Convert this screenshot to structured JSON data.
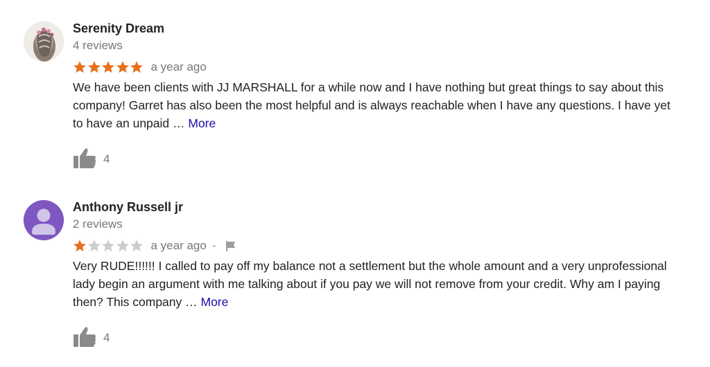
{
  "colors": {
    "star_filled": "#e7711b",
    "star_empty": "#cccccc",
    "link": "#1a0dab",
    "muted": "#777777",
    "avatar_purple": "#7e57c2"
  },
  "reviews": [
    {
      "author": "Serenity Dream",
      "review_count": "4 reviews",
      "rating": 5,
      "rating_max": 5,
      "time": "a year ago",
      "text": "We have been clients with  JJ MARSHALL for a while now and I have nothing but great things to say about this company! Garret has also been the most helpful and is always reachable when I have any questions. I have yet to have an unpaid … ",
      "more_label": "More",
      "likes": "4",
      "avatar_icon": "profile-photo"
    },
    {
      "author": "Anthony Russell jr",
      "review_count": "2 reviews",
      "rating": 1,
      "rating_max": 5,
      "time": "a year ago",
      "separator": "-",
      "text": "Very RUDE!!!!!! I called to pay off my balance not a settlement but the whole amount and a very unprofessional lady begin an argument with me talking about if you pay we will not remove from your credit. Why am I paying then?  This company … ",
      "more_label": "More",
      "likes": "4",
      "avatar_icon": "default-person-icon",
      "flag_icon": "flag-icon"
    }
  ]
}
